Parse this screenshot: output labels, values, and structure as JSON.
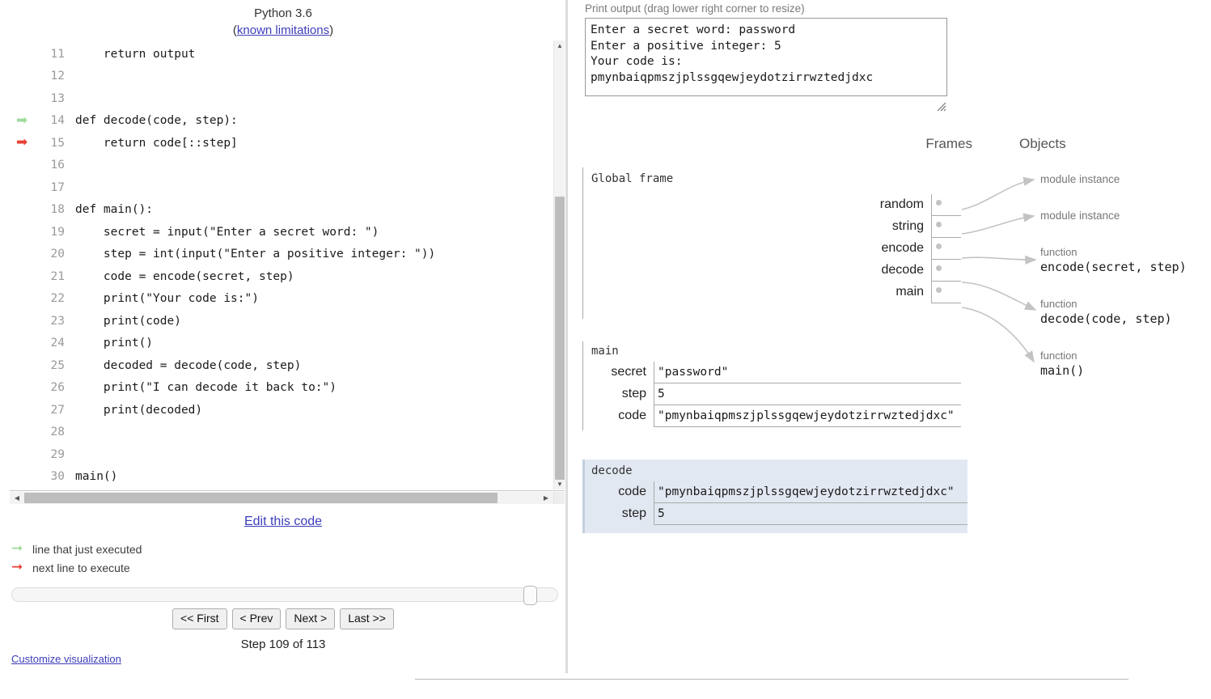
{
  "header": {
    "language": "Python 3.6",
    "limitations_prefix": "(",
    "limitations_link": "known limitations",
    "limitations_suffix": ")"
  },
  "code": {
    "lines": [
      {
        "number": "11",
        "text": "    return output",
        "marker": "none"
      },
      {
        "number": "12",
        "text": "",
        "marker": "none"
      },
      {
        "number": "13",
        "text": "",
        "marker": "none"
      },
      {
        "number": "14",
        "text": "def decode(code, step):",
        "marker": "executed"
      },
      {
        "number": "15",
        "text": "    return code[::step]",
        "marker": "next"
      },
      {
        "number": "16",
        "text": "",
        "marker": "none"
      },
      {
        "number": "17",
        "text": "",
        "marker": "none"
      },
      {
        "number": "18",
        "text": "def main():",
        "marker": "none"
      },
      {
        "number": "19",
        "text": "    secret = input(\"Enter a secret word: \")",
        "marker": "none"
      },
      {
        "number": "20",
        "text": "    step = int(input(\"Enter a positive integer: \"))",
        "marker": "none"
      },
      {
        "number": "21",
        "text": "    code = encode(secret, step)",
        "marker": "none"
      },
      {
        "number": "22",
        "text": "    print(\"Your code is:\")",
        "marker": "none"
      },
      {
        "number": "23",
        "text": "    print(code)",
        "marker": "none"
      },
      {
        "number": "24",
        "text": "    print()",
        "marker": "none"
      },
      {
        "number": "25",
        "text": "    decoded = decode(code, step)",
        "marker": "none"
      },
      {
        "number": "26",
        "text": "    print(\"I can decode it back to:\")",
        "marker": "none"
      },
      {
        "number": "27",
        "text": "    print(decoded)",
        "marker": "none"
      },
      {
        "number": "28",
        "text": "",
        "marker": "none"
      },
      {
        "number": "29",
        "text": "",
        "marker": "none"
      },
      {
        "number": "30",
        "text": "main()",
        "marker": "none"
      }
    ]
  },
  "edit_code_label": "Edit this code",
  "legend": {
    "executed_label": "line that just executed",
    "next_label": "next line to execute",
    "executed_color": "#9ddc9d",
    "next_color": "#e93f33"
  },
  "controls": {
    "first_label": "<< First",
    "prev_label": "< Prev",
    "next_label": "Next >",
    "last_label": "Last >>",
    "step_text": "Step 109 of 113",
    "customize_label": "Customize visualization"
  },
  "print_output": {
    "label": "Print output (drag lower right corner to resize)",
    "text": "Enter a secret word: password\nEnter a positive integer: 5\nYour code is:\npmynbaiqpmszjplssgqewjeydotzirrwztedjdxc"
  },
  "diagram": {
    "frames_header": "Frames",
    "objects_header": "Objects",
    "global_frame": {
      "label": "Global frame",
      "vars": [
        {
          "name": "random",
          "value": "ptr"
        },
        {
          "name": "string",
          "value": "ptr"
        },
        {
          "name": "encode",
          "value": "ptr"
        },
        {
          "name": "decode",
          "value": "ptr"
        },
        {
          "name": "main",
          "value": "ptr"
        }
      ]
    },
    "main_frame": {
      "label": "main",
      "vars": [
        {
          "name": "secret",
          "value": "\"password\""
        },
        {
          "name": "step",
          "value": "5"
        },
        {
          "name": "code",
          "value": "\"pmynbaiqpmszjplssgqewjeydotzirrwztedjdxc\""
        }
      ]
    },
    "decode_frame": {
      "label": "decode",
      "highlight_color": "#e2e8f2",
      "vars": [
        {
          "name": "code",
          "value": "\"pmynbaiqpmszjplssgqewjeydotzirrwztedjdxc\""
        },
        {
          "name": "step",
          "value": "5"
        }
      ]
    },
    "objects": [
      {
        "type": "module instance",
        "name": "",
        "kind": "module"
      },
      {
        "type": "module instance",
        "name": "",
        "kind": "module"
      },
      {
        "type": "function",
        "name": "encode(secret, step)",
        "kind": "function"
      },
      {
        "type": "function",
        "name": "decode(code, step)",
        "kind": "function"
      },
      {
        "type": "function",
        "name": "main()",
        "kind": "function"
      }
    ]
  }
}
